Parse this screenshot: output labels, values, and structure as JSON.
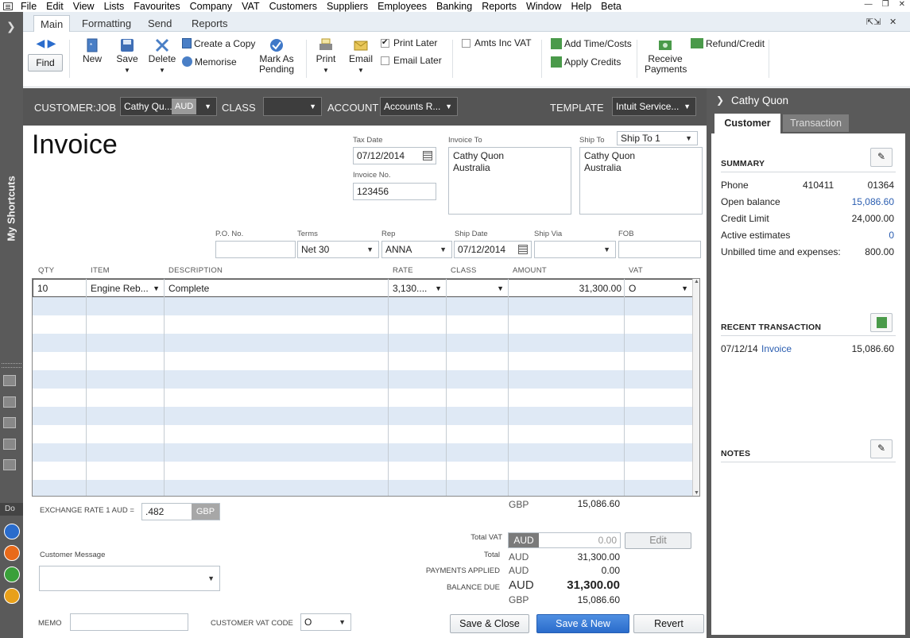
{
  "menubar": {
    "items": [
      "File",
      "Edit",
      "View",
      "Lists",
      "Favourites",
      "Company",
      "VAT",
      "Customers",
      "Suppliers",
      "Employees",
      "Banking",
      "Reports",
      "Window",
      "Help",
      "Beta"
    ]
  },
  "shortcuts": {
    "title": "My Shortcuts",
    "do_label": "Do"
  },
  "tabs": [
    "Main",
    "Formatting",
    "Send",
    "Reports"
  ],
  "toolbar": {
    "new": "New",
    "save": "Save",
    "delete": "Delete",
    "create_copy": "Create a Copy",
    "memorise": "Memorise",
    "mark_as_pending_1": "Mark As",
    "mark_as_pending_2": "Pending",
    "print": "Print",
    "email": "Email",
    "print_later": "Print Later",
    "email_later": "Email Later",
    "amts_inc_vat": "Amts Inc VAT",
    "add_time_costs": "Add Time/Costs",
    "apply_credits": "Apply Credits",
    "receive_payments_1": "Receive",
    "receive_payments_2": "Payments",
    "refund_credit": "Refund/Credit",
    "find": "Find"
  },
  "header": {
    "customer_job_label": "CUSTOMER:JOB",
    "customer_job_value": "Cathy Qu...",
    "customer_currency": "AUD",
    "class_label": "CLASS",
    "class_value": "",
    "account_label": "ACCOUNT",
    "account_value": "Accounts R...",
    "template_label": "TEMPLATE",
    "template_value": "Intuit Service..."
  },
  "form": {
    "title": "Invoice",
    "tax_date_label": "Tax Date",
    "tax_date": "07/12/2014",
    "invoice_no_label": "Invoice No.",
    "invoice_no": "123456",
    "invoice_to_label": "Invoice To",
    "invoice_to": [
      "Cathy Quon",
      "Australia"
    ],
    "ship_to_label": "Ship To",
    "ship_to_select": "Ship To 1",
    "ship_to": [
      "Cathy Quon",
      "Australia"
    ],
    "po_no_label": "P.O. No.",
    "po_no": "",
    "terms_label": "Terms",
    "terms": "Net 30",
    "rep_label": "Rep",
    "rep": "ANNA",
    "ship_date_label": "Ship Date",
    "ship_date": "07/12/2014",
    "ship_via_label": "Ship Via",
    "ship_via": "",
    "fob_label": "FOB",
    "fob": ""
  },
  "grid": {
    "columns": [
      "QTY",
      "ITEM",
      "DESCRIPTION",
      "RATE",
      "CLASS",
      "AMOUNT",
      "VAT"
    ],
    "rows": [
      {
        "qty": "10",
        "item": "Engine Reb...",
        "description": "Complete",
        "rate": "3,130....",
        "class": "",
        "amount": "31,300.00",
        "vat": "O"
      }
    ]
  },
  "footer": {
    "exchange_rate_label": "EXCHANGE RATE 1 AUD =",
    "exchange_rate": ".482",
    "exchange_currency": "GBP",
    "gbp_label": "GBP",
    "gbp_amount": "15,086.60",
    "customer_message_label": "Customer Message",
    "customer_message": "",
    "memo_label": "MEMO",
    "memo": "",
    "customer_vat_code_label": "CUSTOMER VAT CODE",
    "customer_vat_code": "O",
    "total_vat_label": "Total VAT",
    "total_vat_currency": "AUD",
    "total_vat": "0.00",
    "edit_label": "Edit",
    "total_label": "Total",
    "total_currency": "AUD",
    "total": "31,300.00",
    "payments_applied_label": "PAYMENTS APPLIED",
    "payments_currency": "AUD",
    "payments_applied": "0.00",
    "balance_due_label": "BALANCE DUE",
    "balance_currency": "AUD",
    "balance_due": "31,300.00",
    "balance_gbp_currency": "GBP",
    "balance_due_gbp": "15,086.60",
    "save_close": "Save & Close",
    "save_new": "Save & New",
    "revert": "Revert"
  },
  "right_pane": {
    "customer_name": "Cathy Quon",
    "tab_customer": "Customer",
    "tab_transaction": "Transaction",
    "summary_title": "SUMMARY",
    "phone_label": "Phone",
    "phone_1": "410411",
    "phone_2": "01364",
    "open_balance_label": "Open balance",
    "open_balance": "15,086.60",
    "credit_limit_label": "Credit Limit",
    "credit_limit": "24,000.00",
    "active_estimates_label": "Active estimates",
    "active_estimates": "0",
    "unbilled_label": "Unbilled time and expenses:",
    "unbilled": "800.00",
    "recent_title": "RECENT TRANSACTION",
    "recent_date": "07/12/14",
    "recent_type": "Invoice",
    "recent_amount": "15,086.60",
    "notes_title": "NOTES"
  },
  "colors": {
    "accent": "#2a6ccc",
    "dark_bar": "#555555",
    "row_alt": "#dfe9f5"
  }
}
